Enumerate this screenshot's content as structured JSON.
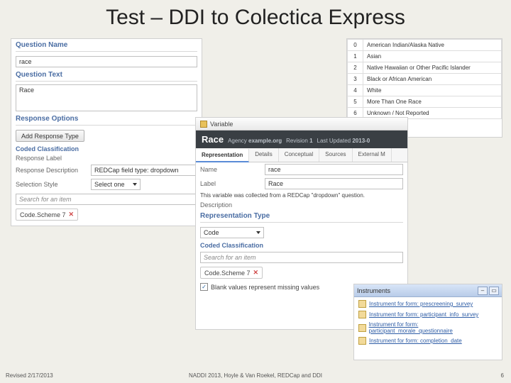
{
  "slide_title": "Test – DDI to Colectica Express",
  "panelA": {
    "section_name": "Question Name",
    "name_value": "race",
    "section_text": "Question Text",
    "text_value": "Race",
    "section_response": "Response Options",
    "add_response_btn": "Add Response Type",
    "section_coded": "Coded Classification",
    "label_response_label": "Response Label",
    "label_response_desc": "Response Description",
    "desc_value": "REDCap field type: dropdown",
    "label_selection_style": "Selection Style",
    "selection_value": "Select one",
    "search_placeholder": "Search for an item",
    "tag_label": "Code.Scheme 7"
  },
  "panelB": {
    "rows": [
      {
        "code": "0",
        "label": "American Indian/Alaska Native"
      },
      {
        "code": "1",
        "label": "Asian"
      },
      {
        "code": "2",
        "label": "Native Hawaiian or Other Pacific Islander"
      },
      {
        "code": "3",
        "label": "Black or African American"
      },
      {
        "code": "4",
        "label": "White"
      },
      {
        "code": "5",
        "label": "More Than One Race"
      },
      {
        "code": "6",
        "label": "Unknown / Not Reported"
      }
    ]
  },
  "panelC": {
    "titlebar": "Variable",
    "title": "Race",
    "agency_label": "Agency",
    "agency_value": "example.org",
    "revision_label": "Revision",
    "revision_value": "1",
    "updated_label": "Last Updated",
    "updated_value": "2013-0",
    "tabs": [
      "Representation",
      "Details",
      "Conceptual",
      "Sources",
      "External M"
    ],
    "name_label": "Name",
    "name_value": "race",
    "label_label": "Label",
    "label_value": "Race",
    "description_label": "Description",
    "description_hint": "This variable was collected from a REDCap \"dropdown\" question.",
    "section_rep_type": "Representation Type",
    "rep_type_value": "Code",
    "section_coded": "Coded Classification",
    "search_placeholder": "Search for an item",
    "tag_label": "Code.Scheme 7",
    "blank_checkbox": "Blank values represent missing values"
  },
  "panelD": {
    "window_title": "Instruments",
    "items": [
      "Instrument for form: prescreening_survey",
      "Instrument for form: participant_info_survey",
      "Instrument for form: participant_morale_questionnaire",
      "Instrument for form: completion_date"
    ]
  },
  "footer": {
    "left": "Revised 2/17/2013",
    "center": "NADDI 2013, Hoyle & Van Roekel, REDCap and DDI",
    "right": "6"
  }
}
